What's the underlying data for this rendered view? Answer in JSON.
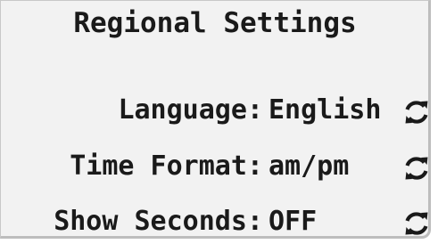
{
  "screen": {
    "title": "Regional Settings"
  },
  "settings": [
    {
      "label": "Language:",
      "value": "English",
      "action_icon": "refresh-icon"
    },
    {
      "label": "Time Format:",
      "value": "am/pm",
      "action_icon": "refresh-icon"
    },
    {
      "label": "Show Seconds:",
      "value": "OFF",
      "action_icon": "refresh-icon"
    }
  ],
  "colors": {
    "background": "#f2f2f2",
    "text": "#1a1a1a",
    "border": "#bdbdbd"
  }
}
